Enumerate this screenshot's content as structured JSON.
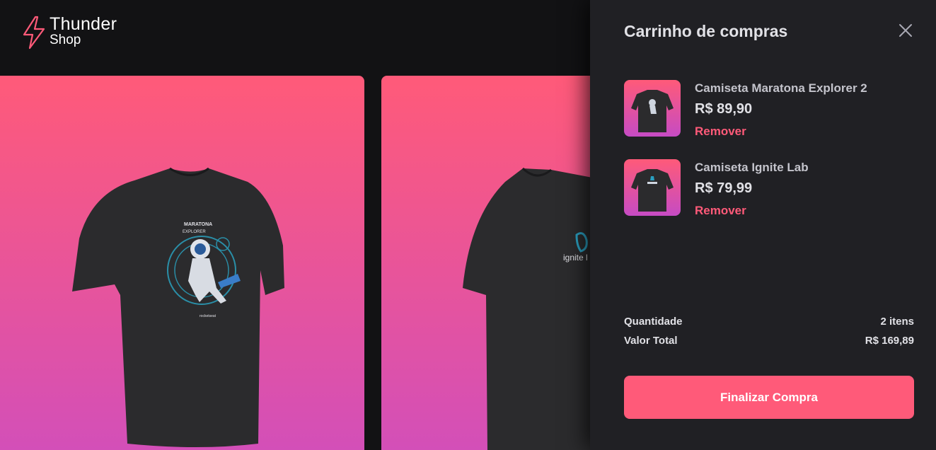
{
  "brand": {
    "title": "Thunder",
    "subtitle": "Shop",
    "accent": "#ff5a79"
  },
  "products": [
    {
      "shirt_print_title": "MARATONA",
      "shirt_print_subtitle": "EXPLORER",
      "shirt_print_brand": "rocketseat"
    },
    {
      "shirt_print_title": "ignite l"
    }
  ],
  "cart": {
    "title": "Carrinho de compras",
    "items": [
      {
        "name": "Camiseta Maratona Explorer 2",
        "price": "R$ 89,90",
        "remove_label": "Remover"
      },
      {
        "name": "Camiseta Ignite Lab",
        "price": "R$ 79,99",
        "remove_label": "Remover"
      }
    ],
    "quantity_label": "Quantidade",
    "quantity_value": "2 itens",
    "total_label": "Valor Total",
    "total_value": "R$ 169,89",
    "checkout_label": "Finalizar Compra"
  },
  "icons": {
    "logo": "lightning-bolt-icon",
    "close": "close-icon"
  }
}
